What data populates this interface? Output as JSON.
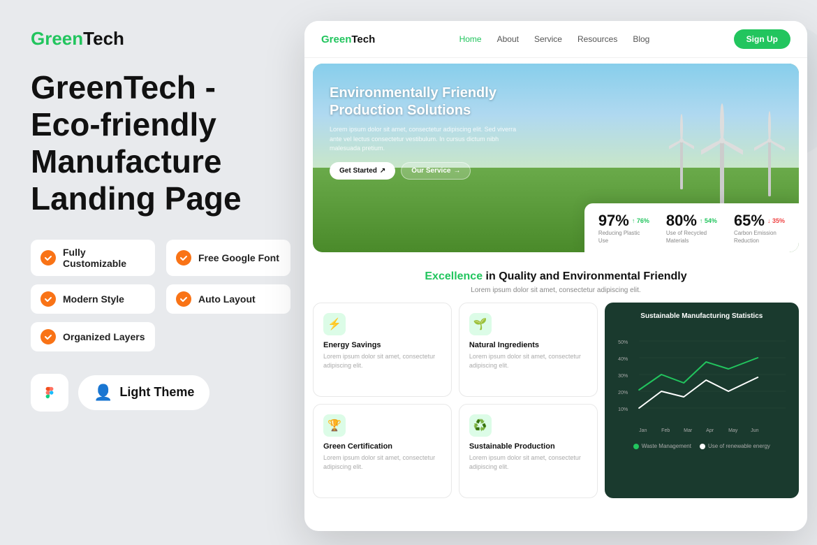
{
  "brand": {
    "green_part": "Green",
    "black_part": "Tech"
  },
  "main_title": "GreenTech - Eco-friendly Manufacture Landing Page",
  "features": [
    {
      "id": "fully-customizable",
      "label": "Fully Customizable"
    },
    {
      "id": "free-google-font",
      "label": "Free Google Font"
    },
    {
      "id": "modern-style",
      "label": "Modern Style"
    },
    {
      "id": "auto-layout",
      "label": "Auto Layout"
    },
    {
      "id": "organized-layers",
      "label": "Organized Layers"
    }
  ],
  "bottom": {
    "theme_label": "Light Theme"
  },
  "browser": {
    "nav": {
      "brand_green": "Green",
      "brand_black": "Tech",
      "links": [
        "Home",
        "About",
        "Service",
        "Resources",
        "Blog"
      ],
      "active_link": "Home",
      "cta_label": "Sign Up"
    },
    "hero": {
      "title": "Environmentally Friendly Production Solutions",
      "description": "Lorem ipsum dolor sit amet, consectetur adipiscing elit. Sed viverra ante vel lectus consectetur vestibulum. In cursus dictum nibh malesuada pretium.",
      "btn_primary": "Get Started",
      "btn_secondary": "Our Service"
    },
    "stats": [
      {
        "number": "97%",
        "change": "↑ 76%",
        "type": "green",
        "label": "Reducing Plastic Use"
      },
      {
        "number": "80%",
        "change": "↑ 54%",
        "type": "green",
        "label": "Use of Recycled Materials"
      },
      {
        "number": "65%",
        "change": "↓ 35%",
        "type": "red",
        "label": "Carbon Emission Reduction"
      }
    ],
    "quality": {
      "highlight": "Excellence",
      "title": " in Quality and Environmental Friendly",
      "description": "Lorem ipsum dolor sit amet, consectetur adipiscing elit."
    },
    "cards": [
      {
        "id": "energy-savings",
        "icon": "⚡",
        "title": "Energy Savings",
        "description": "Lorem ipsum dolor sit amet, consectetur adipiscing elit."
      },
      {
        "id": "natural-ingredients",
        "icon": "🌱",
        "title": "Natural Ingredients",
        "description": "Lorem ipsum dolor sit amet, consectetur adipiscing elit."
      },
      {
        "id": "green-certification",
        "icon": "🏆",
        "title": "Green Certification",
        "description": "Lorem ipsum dolor sit amet, consectetur adipiscing elit."
      },
      {
        "id": "sustainable-production",
        "icon": "♻️",
        "title": "Sustainable Production",
        "description": "Lorem ipsum dolor sit amet, consectetur adipiscing elit."
      }
    ],
    "chart": {
      "title": "Sustainable Manufacturing Statistics",
      "y_labels": [
        "50%",
        "40%",
        "30%",
        "20%",
        "10%"
      ],
      "x_labels": [
        "Jan",
        "Feb",
        "Mar",
        "Apr",
        "May",
        "Jun"
      ],
      "legend": [
        {
          "color": "#22c55e",
          "label": "Waste Management"
        },
        {
          "color": "#fff",
          "label": "Use of renewable energy"
        }
      ]
    }
  }
}
